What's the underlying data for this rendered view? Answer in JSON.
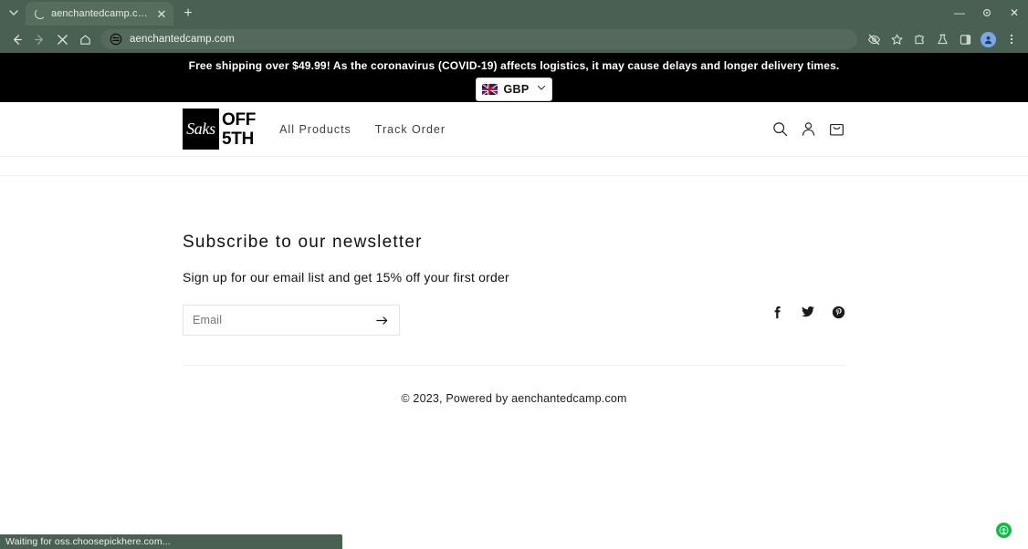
{
  "browser": {
    "tab": {
      "title": "aenchantedcamp.com",
      "close_label": "✕",
      "spinner_name": "loading-spinner"
    },
    "newtab_label": "+",
    "window_controls": {
      "minimize": "—",
      "maximize": "⬚",
      "close": "✕"
    },
    "toolbar": {
      "back_label": "←",
      "forward_label": "→",
      "stop_label": "✕",
      "home_label": "⌂",
      "url": "aenchantedcamp.com"
    },
    "statusbar": {
      "text": "Waiting for oss.choosepickhere.com..."
    }
  },
  "announcement": {
    "text": "Free shipping over $49.99! As the coronavirus (COVID-19) affects logistics, it may cause delays and longer delivery times.",
    "currency": {
      "label": "GBP",
      "flag": "uk-flag",
      "chevron": "⌄"
    }
  },
  "header": {
    "logo": {
      "mark_text": "Saks",
      "line1": "OFF",
      "line2": "5TH"
    },
    "nav": [
      {
        "label": "All Products"
      },
      {
        "label": "Track Order"
      }
    ],
    "icons": [
      {
        "name": "search-icon"
      },
      {
        "name": "account-icon"
      },
      {
        "name": "cart-icon"
      }
    ]
  },
  "newsletter": {
    "title": "Subscribe to our newsletter",
    "subtitle": "Sign up for our email list and get 15% off your first order",
    "email_placeholder": "Email",
    "email_value": "",
    "submit_label": "→",
    "socials": [
      {
        "name": "facebook-icon"
      },
      {
        "name": "twitter-icon"
      },
      {
        "name": "pinterest-icon"
      }
    ]
  },
  "footer": {
    "copyright": "© 2023, Powered by aenchantedcamp.com"
  },
  "colors": {
    "chrome": "#4a6052",
    "tab_active": "#566d5d",
    "announce_bg": "#000000",
    "badge_green": "#0fbb44"
  }
}
